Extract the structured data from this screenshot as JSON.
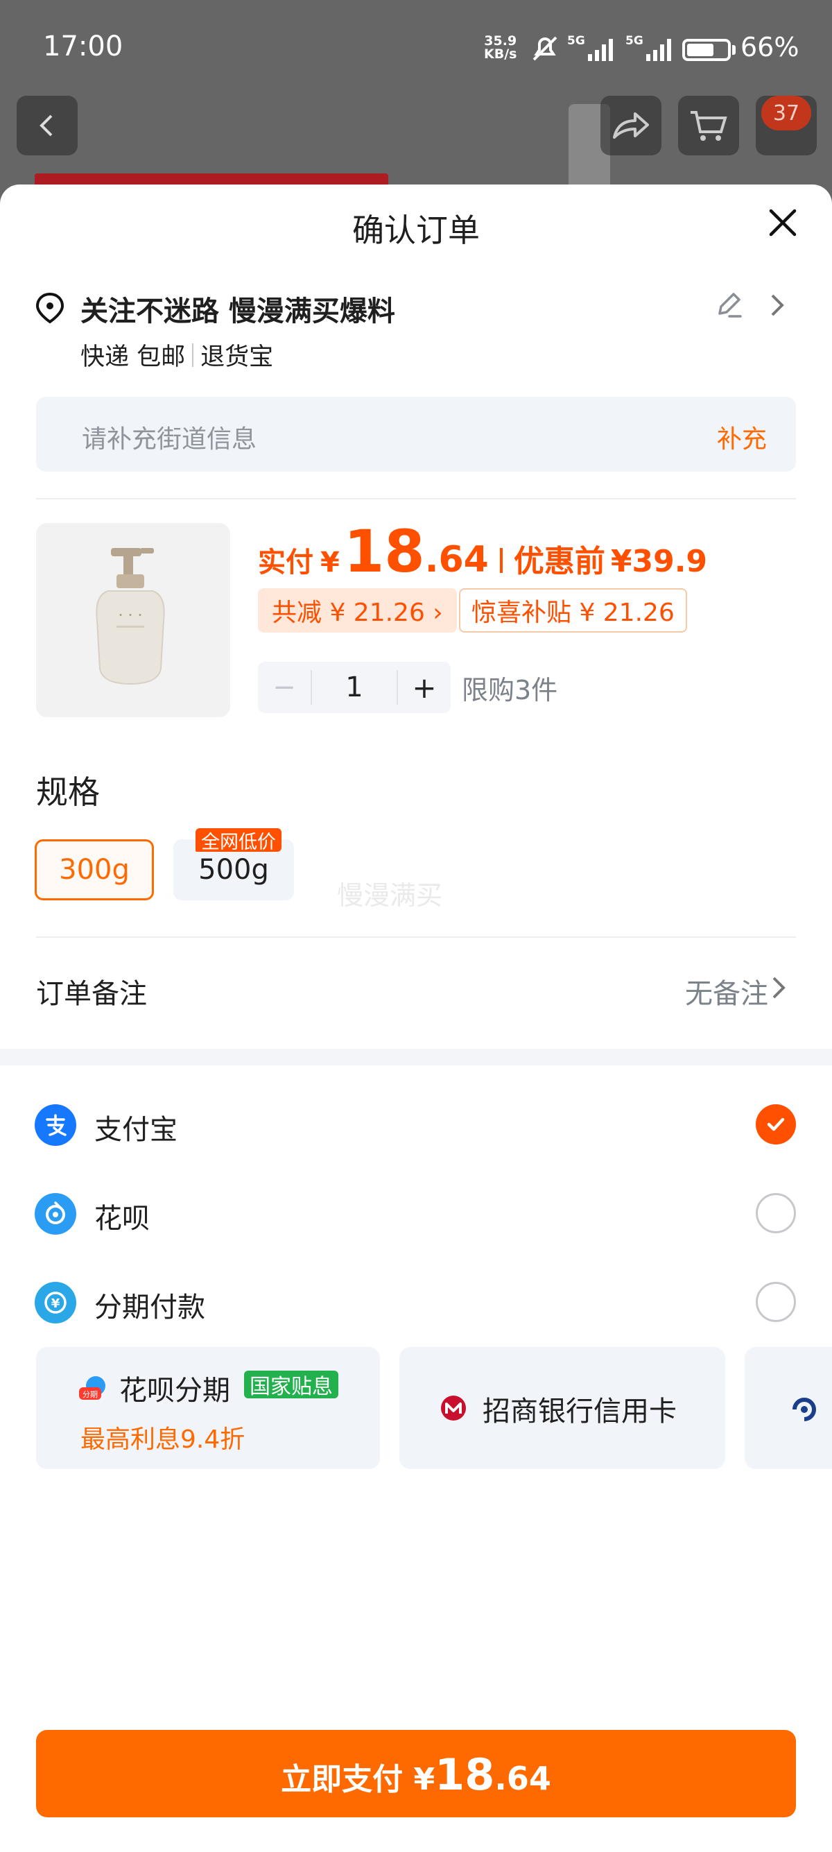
{
  "status_bar": {
    "time": "17:00",
    "net_speed": "35.9",
    "net_unit": "KB/s",
    "sig1": "5G",
    "sig2": "5G",
    "battery": "66%"
  },
  "background": {
    "cart_badge": "37"
  },
  "sheet": {
    "title": "确认订单"
  },
  "address": {
    "title": "关注不迷路 慢漫满买爆料",
    "delivery": "快递 包邮",
    "return_service": "退货宝",
    "street_placeholder": "请补充街道信息",
    "street_action": "补充"
  },
  "product": {
    "pay_label": "实付",
    "currency": "¥",
    "price_int": "18",
    "price_dec": ".64",
    "orig_label": "优惠前",
    "orig_price": "¥39.9",
    "discount_tag": "共减 ¥ 21.26 ›",
    "subsidy_tag": "惊喜补贴 ¥ 21.26",
    "qty_minus": "−",
    "quantity": "1",
    "qty_plus": "+",
    "limit": "限购3件"
  },
  "spec": {
    "title": "规格",
    "options": [
      "300g",
      "500g"
    ],
    "selected": "300g",
    "badge": "全网低价",
    "watermark": "慢漫满买"
  },
  "note": {
    "label": "订单备注",
    "value": "无备注"
  },
  "payment": {
    "methods": [
      {
        "label": "支付宝",
        "icon": "alipay-icon",
        "selected": true
      },
      {
        "label": "花呗",
        "icon": "huabei-icon",
        "selected": false
      },
      {
        "label": "分期付款",
        "icon": "installment-icon",
        "selected": false
      }
    ],
    "cards": [
      {
        "title": "花呗分期",
        "badge": "国家贴息",
        "subtitle": "最高利息9.4折"
      },
      {
        "title": "招商银行信用卡"
      }
    ]
  },
  "pay_button": {
    "prefix": "立即支付 ¥",
    "price_int": "18",
    "price_dec": ".64"
  },
  "colors": {
    "accent": "#ff6a00",
    "price": "#ff5000",
    "alipay": "#1677ff",
    "gov_badge": "#23b14d"
  }
}
